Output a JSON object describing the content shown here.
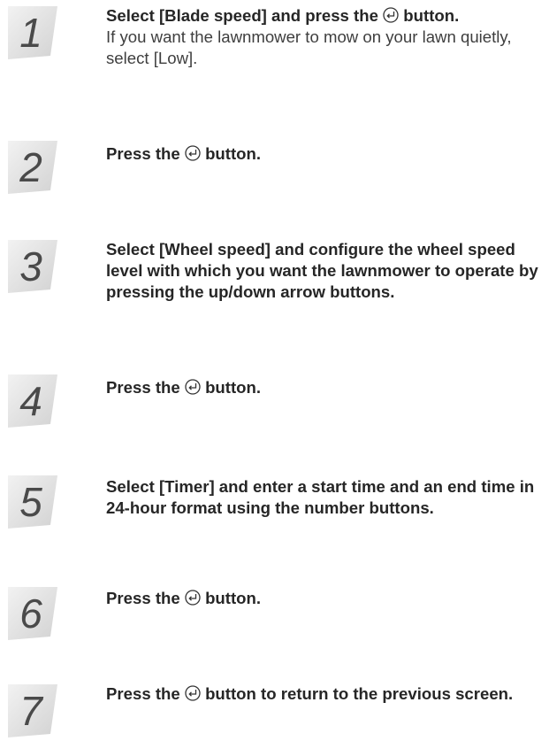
{
  "steps": [
    {
      "number": "1",
      "before": "Select [Blade speed] and press the",
      "after": "button.",
      "note": "If you want the lawnmower to mow on your lawn quietly, select [Low]."
    },
    {
      "number": "2",
      "before": "Press the",
      "after": "button."
    },
    {
      "number": "3",
      "text": "Select [Wheel speed] and configure the wheel speed level with which you want the lawnmower to operate by pressing the up/down arrow buttons."
    },
    {
      "number": "4",
      "before": "Press the",
      "after": "button."
    },
    {
      "number": "5",
      "text": "Select [Timer] and enter a start time and an end time in 24-hour format using the number buttons."
    },
    {
      "number": "6",
      "before": "Press the",
      "after": "button."
    },
    {
      "number": "7",
      "before": "Press the",
      "after": "button to return to the previous screen."
    }
  ],
  "icons": {
    "enter": "enter-return-icon"
  }
}
